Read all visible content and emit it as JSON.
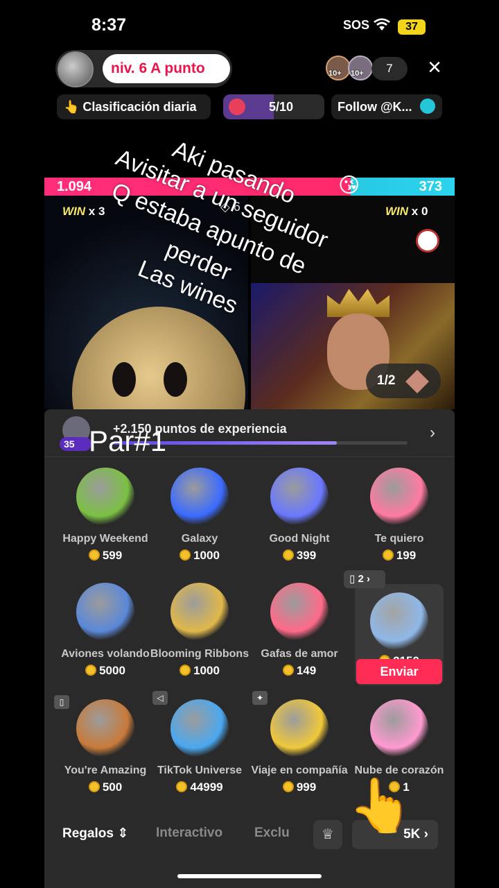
{
  "status": {
    "time": "8:37",
    "sos": "SOS",
    "battery": "37"
  },
  "header": {
    "level_badge": "niv. 6  A punto",
    "viewer_tags": [
      "10+",
      "10+"
    ],
    "viewer_count": "7",
    "close_icon": "×"
  },
  "chips": {
    "rank": "👆 Clasificación diaria",
    "progress": "5/10",
    "progress_fraction": 0.5,
    "follow": "Follow @K..."
  },
  "battle": {
    "score_left": "1.094",
    "score_right": "373",
    "left_fraction": 0.746,
    "win_left_label": "WIN",
    "win_left_count": "x 3",
    "win_right_label": "WIN",
    "win_right_count": "x 0",
    "center_badge": "6",
    "page_indicator": "1/2"
  },
  "caption": {
    "line1": "Aki pasando",
    "line2": "Avisitar a un seguidor",
    "line3": "Q estaba apunto de",
    "line4": "perder",
    "line5": "Las wines"
  },
  "experience": {
    "badge": "35",
    "text": "+2.150 puntos de experiencia",
    "progress_fraction": 0.76,
    "overlay_label": "Par#1"
  },
  "gifts": [
    {
      "name": "Happy Weekend",
      "price": "599",
      "color": "#7bc043"
    },
    {
      "name": "Galaxy",
      "price": "1000",
      "color": "#3b6bff"
    },
    {
      "name": "Good Night",
      "price": "399",
      "color": "#6a78ff"
    },
    {
      "name": "Te quiero",
      "price": "199",
      "color": "#ff7aa0"
    },
    {
      "name": "Aviones volando",
      "price": "5000",
      "color": "#5a88d8"
    },
    {
      "name": "Blooming Ribbons",
      "price": "1000",
      "color": "#e0b84a"
    },
    {
      "name": "Gafas de amor",
      "price": "149",
      "color": "#ff6a8a"
    },
    {
      "name": "",
      "price": "2150",
      "color": "#8fb8e8"
    },
    {
      "name": "You're Amazing",
      "price": "500",
      "color": "#c87a3a"
    },
    {
      "name": "TikTok Universe",
      "price": "44999",
      "color": "#4aa8f0"
    },
    {
      "name": "Viaje en compañía",
      "price": "999",
      "color": "#f0c83a"
    },
    {
      "name": "Nube de corazón",
      "price": "1",
      "color": "#ff9ad0"
    }
  ],
  "selected_gift": {
    "multiplier": "2",
    "send_label": "Enviar"
  },
  "tabs": {
    "gifts": "Regalos",
    "interactive": "Interactivo",
    "exclusive": "Exclu",
    "coins": "5K"
  }
}
